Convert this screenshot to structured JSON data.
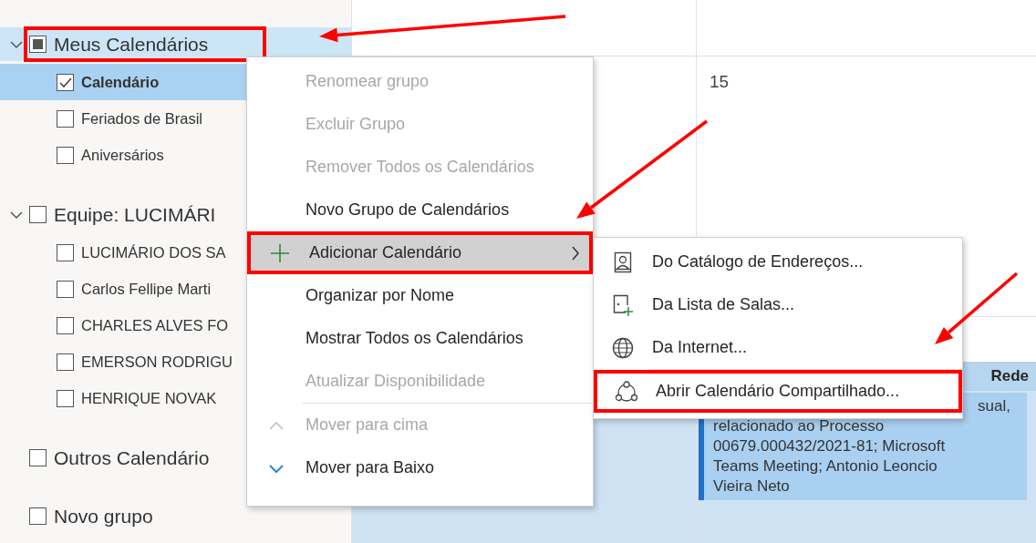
{
  "sidebar": {
    "groups": [
      {
        "label": "Meus Calendários",
        "expanded": true,
        "checked": false,
        "indeterminate": true,
        "selected": true,
        "highlighted": true,
        "items": [
          {
            "label": "Calendário",
            "checked": true,
            "selected": true
          },
          {
            "label": "Feriados de Brasil",
            "checked": false,
            "selected": false
          },
          {
            "label": "Aniversários",
            "checked": false,
            "selected": false
          }
        ]
      },
      {
        "label": "Equipe: LUCIMÁRI",
        "expanded": true,
        "checked": false,
        "indeterminate": false,
        "selected": false,
        "items": [
          {
            "label": "LUCIMÁRIO DOS SA",
            "checked": false,
            "selected": false
          },
          {
            "label": "Carlos Fellipe Marti",
            "checked": false,
            "selected": false
          },
          {
            "label": "CHARLES ALVES FO",
            "checked": false,
            "selected": false
          },
          {
            "label": "EMERSON RODRIGU",
            "checked": false,
            "selected": false
          },
          {
            "label": "HENRIQUE NOVAK",
            "checked": false,
            "selected": false
          }
        ]
      },
      {
        "label": "Outros Calendário",
        "checked": false,
        "indeterminate": false,
        "selected": false
      },
      {
        "label": "Novo grupo",
        "checked": false,
        "indeterminate": false,
        "selected": false
      }
    ]
  },
  "calendar": {
    "day_number": "15",
    "column_header": "Rede",
    "event": {
      "lines": [
        "sual,",
        "relacionado ao Processo",
        "00679.000432/2021-81; Microsoft",
        "Teams Meeting; Antonio Leoncio",
        "Vieira Neto"
      ]
    }
  },
  "context_menu": {
    "items": [
      {
        "kind": "plain",
        "label": "Renomear grupo",
        "disabled": true,
        "selected": false
      },
      {
        "kind": "plain",
        "label": "Excluir Grupo",
        "disabled": true,
        "selected": false
      },
      {
        "kind": "plain",
        "label": "Remover Todos os Calendários",
        "disabled": true,
        "selected": false
      },
      {
        "kind": "plain",
        "label": "Novo Grupo de Calendários",
        "disabled": false,
        "selected": false
      },
      {
        "kind": "add",
        "label": "Adicionar Calendário",
        "submenu": true,
        "disabled": false,
        "selected": true,
        "highlighted": true
      },
      {
        "kind": "plain",
        "label": "Organizar por Nome",
        "disabled": false,
        "selected": false
      },
      {
        "kind": "plain",
        "label": "Mostrar Todos os Calendários",
        "disabled": false,
        "selected": false
      },
      {
        "kind": "plain",
        "label": "Atualizar Disponibilidade",
        "disabled": true,
        "selected": false
      },
      {
        "kind": "separator"
      },
      {
        "kind": "up",
        "label": "Mover para cima",
        "disabled": true,
        "selected": false
      },
      {
        "kind": "down",
        "label": "Mover para Baixo",
        "disabled": false,
        "selected": false
      }
    ]
  },
  "submenu": {
    "items": [
      {
        "kind": "contact",
        "label": "Do Catálogo de Endereços...",
        "disabled": false,
        "selected": false
      },
      {
        "kind": "room",
        "label": "Da Lista de Salas...",
        "disabled": false,
        "selected": false
      },
      {
        "kind": "globe",
        "label": "Da Internet...",
        "disabled": false,
        "selected": false
      },
      {
        "kind": "separator"
      },
      {
        "kind": "shared",
        "label": "Abrir Calendário Compartilhado...",
        "disabled": false,
        "selected": false,
        "highlighted": true
      }
    ]
  }
}
